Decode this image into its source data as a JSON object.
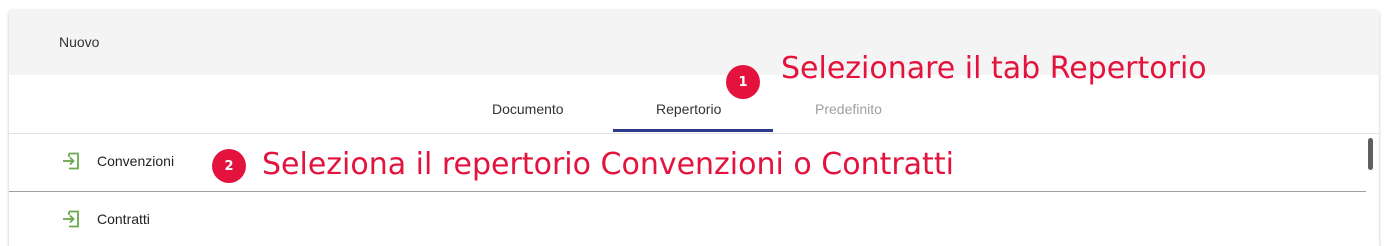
{
  "panel": {
    "title": "Nuovo"
  },
  "tabs": [
    {
      "label": "Documento",
      "state": "normal"
    },
    {
      "label": "Repertorio",
      "state": "selected"
    },
    {
      "label": "Predefinito",
      "state": "disabled"
    }
  ],
  "list": {
    "items": [
      {
        "label": "Convenzioni",
        "icon": "enter-arrow-icon"
      },
      {
        "label": "Contratti",
        "icon": "enter-arrow-icon"
      }
    ]
  },
  "annotations": [
    {
      "number": "1",
      "text": "Selezionare il tab Repertorio"
    },
    {
      "number": "2",
      "text": "Seleziona il repertorio Convenzioni o Contratti"
    }
  ],
  "colors": {
    "accent_red": "#e3133d",
    "tab_indicator": "#2e3a8c",
    "icon_green": "#6aa84f"
  }
}
